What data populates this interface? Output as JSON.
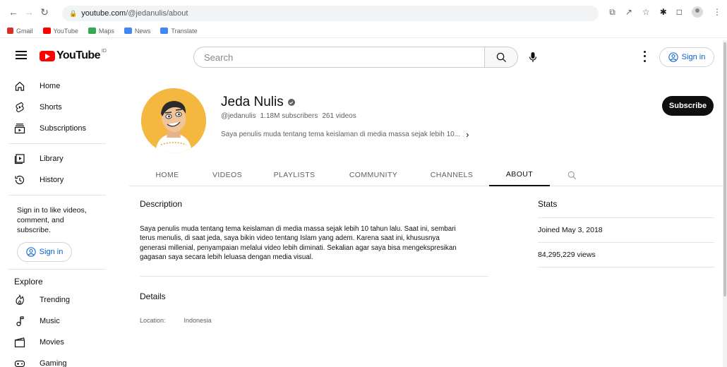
{
  "browser": {
    "url_host": "youtube.com",
    "url_path": "/@jedanulis/about",
    "bookmarks": [
      {
        "label": "Gmail",
        "color": "#d93025"
      },
      {
        "label": "YouTube",
        "color": "#ff0000"
      },
      {
        "label": "Maps",
        "color": "#34a853"
      },
      {
        "label": "News",
        "color": "#4285f4"
      },
      {
        "label": "Translate",
        "color": "#4285f4"
      }
    ]
  },
  "header": {
    "logo_text": "YouTube",
    "region": "ID",
    "search_placeholder": "Search",
    "signin_label": "Sign in"
  },
  "sidebar": {
    "primary": [
      {
        "label": "Home",
        "icon": "home-icon"
      },
      {
        "label": "Shorts",
        "icon": "shorts-icon"
      },
      {
        "label": "Subscriptions",
        "icon": "subscriptions-icon"
      }
    ],
    "secondary": [
      {
        "label": "Library",
        "icon": "library-icon"
      },
      {
        "label": "History",
        "icon": "history-icon"
      }
    ],
    "signin_note": "Sign in to like videos, comment, and subscribe.",
    "signin_label": "Sign in",
    "explore_heading": "Explore",
    "explore": [
      {
        "label": "Trending",
        "icon": "trending-icon"
      },
      {
        "label": "Music",
        "icon": "music-icon"
      },
      {
        "label": "Movies",
        "icon": "movies-icon"
      },
      {
        "label": "Gaming",
        "icon": "gaming-icon"
      }
    ]
  },
  "channel": {
    "name": "Jeda Nulis",
    "handle": "@jedanulis",
    "subscribers": "1.18M subscribers",
    "videos": "261 videos",
    "description_preview": "Saya penulis muda tentang tema keislaman di media massa sejak lebih 10...",
    "subscribe_label": "Subscribe",
    "tabs": [
      {
        "label": "HOME",
        "active": false
      },
      {
        "label": "VIDEOS",
        "active": false
      },
      {
        "label": "PLAYLISTS",
        "active": false
      },
      {
        "label": "COMMUNITY",
        "active": false
      },
      {
        "label": "CHANNELS",
        "active": false
      },
      {
        "label": "ABOUT",
        "active": true
      }
    ]
  },
  "about": {
    "description_title": "Description",
    "description_lines": [
      "Saya penulis muda tentang tema keislaman di media massa sejak lebih 10 tahun lalu. Saat ini, sembari",
      "terus menulis, di saat jeda, saya bikin video tentang Islam yang adem. Karena saat ini, khususnya",
      "generasi millenial, penyampaian melalui video lebih diminati. Sekalian agar saya bisa mengekspresikan",
      "gagasan saya secara lebih leluasa dengan media visual."
    ],
    "details_title": "Details",
    "location_label": "Location:",
    "location_value": "Indonesia",
    "stats_title": "Stats",
    "joined": "Joined May 3, 2018",
    "views": "84,295,229 views"
  }
}
